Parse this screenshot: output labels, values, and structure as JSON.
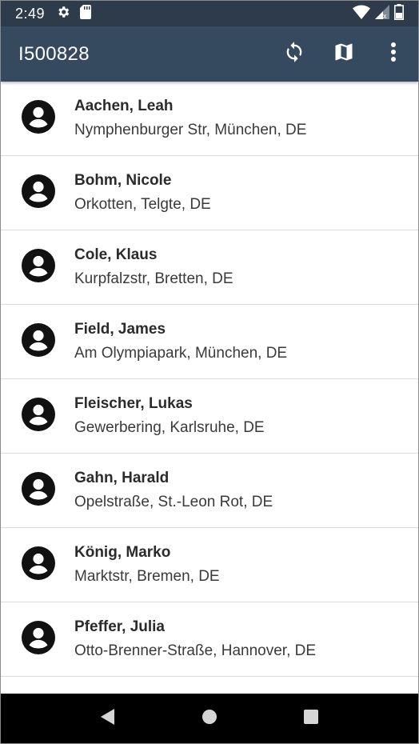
{
  "status_bar": {
    "time": "2:49",
    "left_icons": [
      "gear-icon",
      "sd-card-icon"
    ],
    "right_icons": [
      "wifi-icon",
      "signal-icon",
      "battery-icon"
    ]
  },
  "app_bar": {
    "title": "I500828",
    "actions": [
      "sync-icon",
      "map-icon",
      "more-vert-icon"
    ],
    "background": "#354a5f"
  },
  "contacts": [
    {
      "name": "Aachen, Leah",
      "address": "Nymphenburger Str, München, DE"
    },
    {
      "name": "Bohm, Nicole",
      "address": "Orkotten, Telgte, DE"
    },
    {
      "name": "Cole, Klaus",
      "address": "Kurpfalzstr, Bretten, DE"
    },
    {
      "name": "Field, James",
      "address": "Am Olympiapark, München, DE"
    },
    {
      "name": "Fleischer, Lukas",
      "address": "Gewerbering, Karlsruhe, DE"
    },
    {
      "name": "Gahn, Harald",
      "address": "Opelstraße, St.-Leon Rot, DE"
    },
    {
      "name": "König, Marko",
      "address": "Marktstr, Bremen, DE"
    },
    {
      "name": "Pfeffer, Julia",
      "address": "Otto-Brenner-Straße, Hannover, DE"
    }
  ],
  "nav_bar": {
    "buttons": [
      "back-icon",
      "home-icon",
      "recents-icon"
    ]
  }
}
